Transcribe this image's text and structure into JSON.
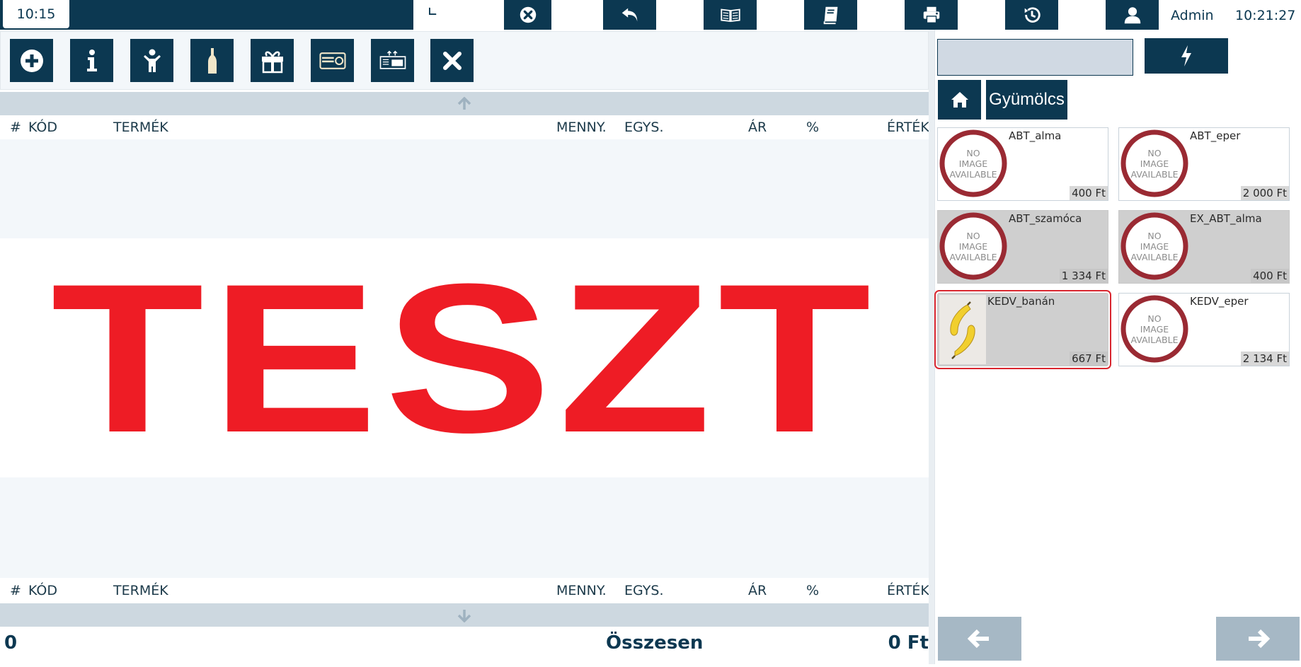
{
  "topbar": {
    "time_left": "10:15",
    "user": "Admin",
    "time_right": "10:21:27",
    "icons": [
      "pie-chart-icon",
      "close-circle-icon",
      "undo-icon",
      "open-book-icon",
      "book-icon",
      "printer-icon",
      "history-icon",
      "user-icon"
    ]
  },
  "toolbar": {
    "buttons": [
      "add-icon",
      "info-icon",
      "child-icon",
      "bottle-icon",
      "gift-icon",
      "card-icon",
      "price-tag-icon",
      "close-icon"
    ]
  },
  "table": {
    "headers": {
      "num": "#",
      "code": "KÓD",
      "product": "TERMÉK",
      "qty": "MENNY.",
      "unit": "EGYS.",
      "price": "ÁR",
      "percent": "%",
      "value": "ÉRTÉK"
    },
    "watermark": "TESZT"
  },
  "footer": {
    "count": "0",
    "total_label": "Összesen",
    "total_value": "0 Ft"
  },
  "right": {
    "search_value": "",
    "category": "Gyümölcs",
    "no_image_text": [
      "NO",
      "IMAGE",
      "AVAILABLE"
    ],
    "products": [
      {
        "name": "ABT_alma",
        "price": "400 Ft",
        "grey": false,
        "image": "none",
        "selected": false
      },
      {
        "name": "ABT_eper",
        "price": "2 000 Ft",
        "grey": false,
        "image": "none",
        "selected": false
      },
      {
        "name": "ABT_szamóca",
        "price": "1 334 Ft",
        "grey": true,
        "image": "none",
        "selected": false
      },
      {
        "name": "EX_ABT_alma",
        "price": "400 Ft",
        "grey": true,
        "image": "none",
        "selected": false
      },
      {
        "name": "KEDV_banán",
        "price": "667 Ft",
        "grey": true,
        "image": "banana-photo",
        "selected": true
      },
      {
        "name": "KEDV_eper",
        "price": "2 134 Ft",
        "grey": false,
        "image": "none",
        "selected": false
      }
    ]
  },
  "colors": {
    "primary": "#0c3851",
    "watermark": "#ee1c25",
    "selection": "#d9262f",
    "noimage_ring": "#9a2a33"
  }
}
